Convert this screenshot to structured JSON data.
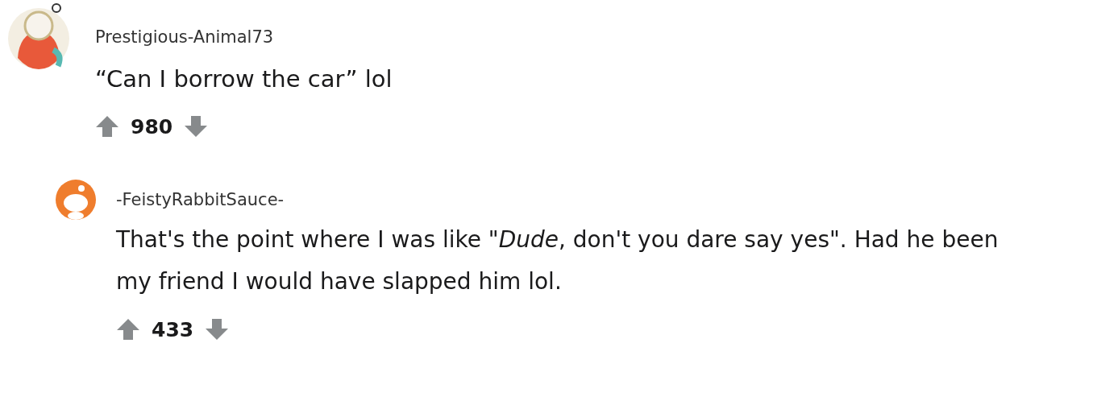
{
  "comments": [
    {
      "username": "Prestigious-Animal73",
      "body": "“Can I borrow the car” lol",
      "score": "980",
      "children": [
        {
          "username": "-FeistyRabbitSauce-",
          "body": "That's the point where I was like \"*Dude*, don't you dare say yes\". Had he been my friend I would have slapped him lol.",
          "score": "433"
        }
      ]
    }
  ]
}
